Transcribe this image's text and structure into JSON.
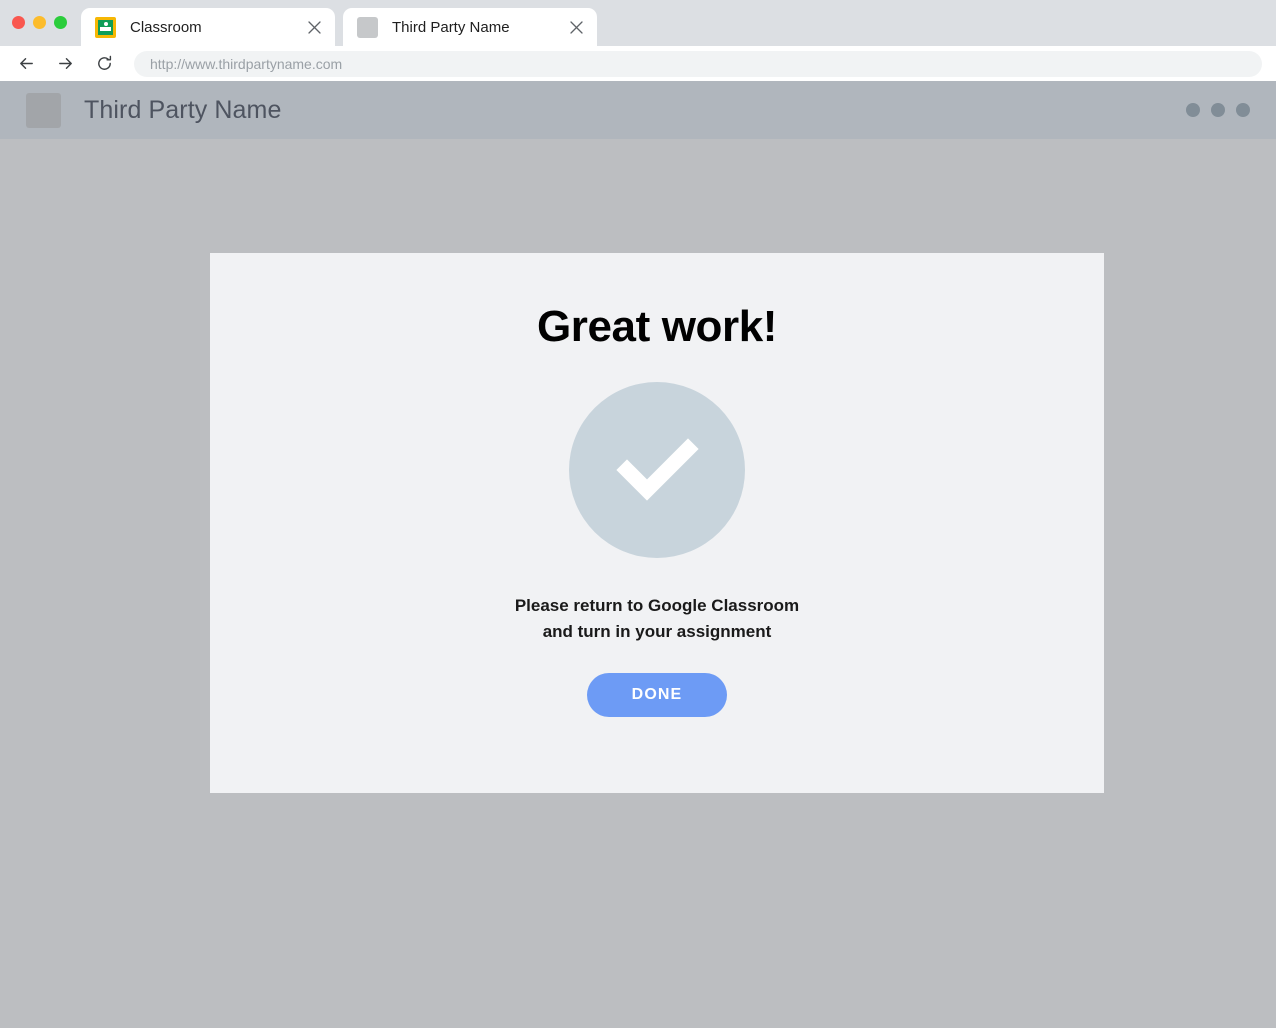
{
  "window": {
    "traffic_lights": [
      {
        "name": "close",
        "color": "#f9574f"
      },
      {
        "name": "minimize",
        "color": "#fcbc2c"
      },
      {
        "name": "maximize",
        "color": "#2bcd3c"
      }
    ]
  },
  "tabs": [
    {
      "title": "Classroom",
      "favicon": "google-classroom-icon",
      "close_label": "×",
      "active": false
    },
    {
      "title": "Third Party Name",
      "favicon": "blank-favicon-icon",
      "close_label": "×",
      "active": true
    }
  ],
  "toolbar": {
    "back_icon": "arrow-left-icon",
    "forward_icon": "arrow-right-icon",
    "reload_icon": "reload-icon",
    "url_value": "http://www.thirdpartyname.com",
    "url_placeholder": "Search or type URL"
  },
  "site_header": {
    "logo": "site-logo-placeholder",
    "title": "Third Party Name",
    "menu_icon": "three-dots-icon",
    "background_color": "#b0b6bd",
    "dot_color": "#818d97"
  },
  "card": {
    "heading": "Great work!",
    "status_icon": "checkmark-circle-icon",
    "status_icon_color": "#c8d4dc",
    "message_line_1": "Please return to Google Classroom",
    "message_line_2": "and turn in your assignment",
    "done_label": "DONE",
    "done_color": "#6d9bf5",
    "background_color": "#f1f2f4"
  },
  "page": {
    "background_color": "#bcbec1"
  }
}
